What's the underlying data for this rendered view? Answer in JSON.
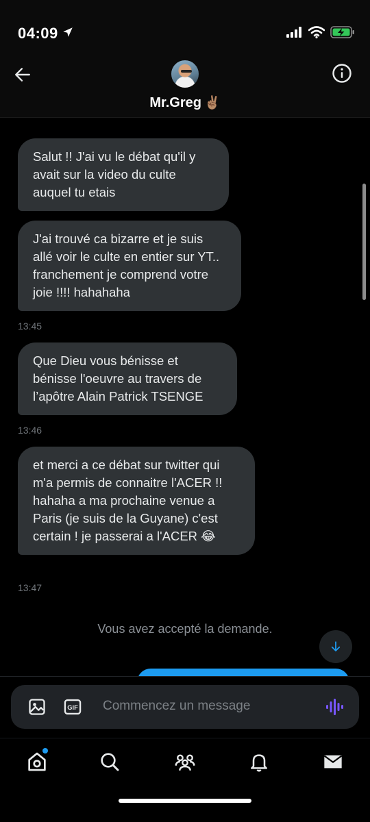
{
  "status_bar": {
    "time": "04:09"
  },
  "header": {
    "contact_name": "Mr.Greg",
    "name_emoji": "✌🏽"
  },
  "messages": [
    {
      "text": "Salut !! J'ai vu le débat qu'il y avait sur la video du culte auquel tu etais"
    },
    {
      "text": "J'ai trouvé ca bizarre et je suis allé voir le culte en entier sur YT.. franchement je comprend votre joie !!!! hahahaha"
    },
    {
      "text": "Que Dieu vous bénisse et bénisse l'oeuvre au travers de l’apôtre Alain Patrick TSENGE"
    },
    {
      "text": "et merci a ce débat sur twitter qui m'a permis de connaitre l'ACER !! hahaha a ma prochaine venue a Paris (je suis de la Guyane) c'est certain ! je passerai a l'ACER 😂"
    }
  ],
  "timestamps": [
    "13:45",
    "13:46",
    "13:47"
  ],
  "system_note": "Vous avez accepté la demande.",
  "composer": {
    "placeholder": "Commencez un message",
    "gif_label": "GIF"
  },
  "colors": {
    "accent": "#1d9bf0",
    "bubble_received": "#2f3336",
    "voice": "#7856ff"
  },
  "icons": {
    "back": "arrow-left-icon",
    "info": "info-icon",
    "image": "image-icon",
    "gif": "gif-icon",
    "voice": "voice-waveform-icon",
    "scroll_down": "arrow-down-icon",
    "tabs": [
      "home-icon",
      "search-icon",
      "communities-icon",
      "bell-icon",
      "mail-icon"
    ]
  }
}
